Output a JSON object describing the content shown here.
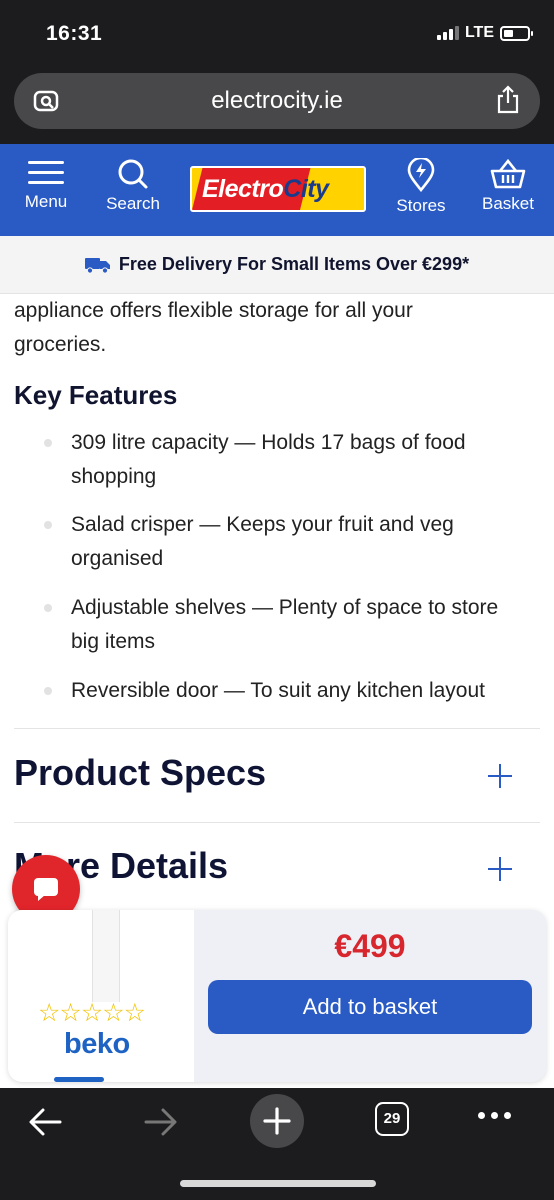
{
  "status_bar": {
    "time": "16:31",
    "network": "LTE"
  },
  "browser": {
    "url": "electrocity.ie",
    "left_icon": "page-tools-icon",
    "right_icon": "share-icon",
    "tab_count": "29"
  },
  "header": {
    "menu_label": "Menu",
    "search_label": "Search",
    "logo_part1": "Electro",
    "logo_part2": "City",
    "stores_label": "Stores",
    "basket_label": "Basket",
    "bg_color": "#2a5bc4"
  },
  "delivery_banner": {
    "text": "Free Delivery For Small Items Over €299*"
  },
  "content": {
    "intro_line1": "appliance offers flexible storage for all your",
    "intro_line2": "groceries.",
    "key_features_heading": "Key Features",
    "features": [
      {
        "line1": "309 litre capacity — Holds 17 bags of food",
        "line2": "shopping"
      },
      {
        "line1": "Salad crisper — Keeps your fruit and veg",
        "line2": "organised"
      },
      {
        "line1": "Adjustable shelves — Plenty of space to store",
        "line2": "big items"
      },
      {
        "line1": "Reversible door — To suit any kitchen layout",
        "line2": ""
      }
    ],
    "accordions": [
      {
        "title": "Product Specs"
      },
      {
        "title": "More Details"
      }
    ]
  },
  "sticky_bar": {
    "stars": "☆☆☆☆☆",
    "brand": "beko",
    "price": "€499",
    "add_button": "Add to basket",
    "price_color": "#d7262d"
  }
}
